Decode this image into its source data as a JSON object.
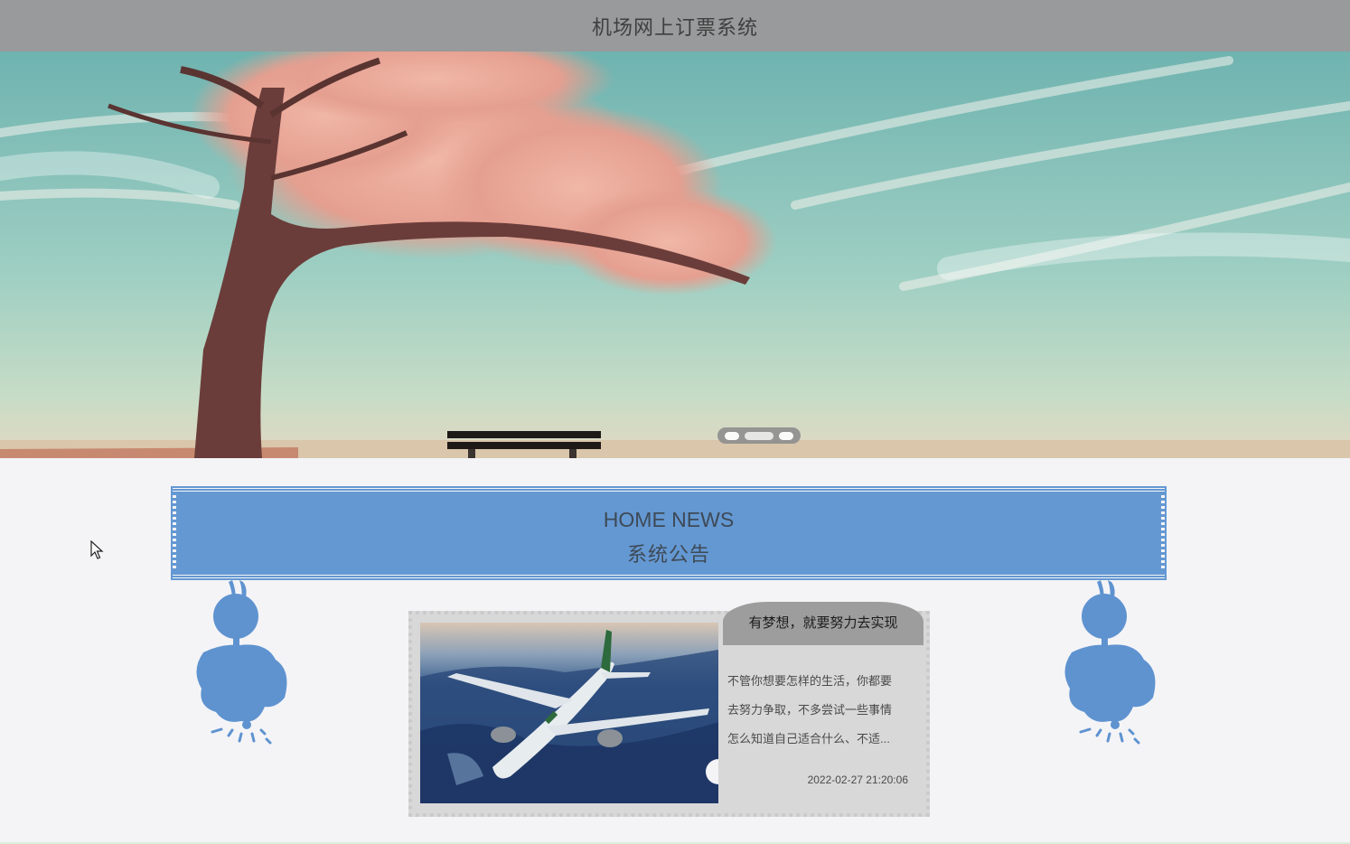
{
  "header": {
    "title": "机场网上订票系统"
  },
  "carousel": {
    "slide_count": 3,
    "active_index": 1
  },
  "news": {
    "title_en": "HOME NEWS",
    "title_zh": "系统公告",
    "items": [
      {
        "title": "有梦想，就要努力去实现",
        "lines": [
          "不管你想要怎样的生活，你都要",
          "去努力争取，不多尝试一些事情",
          "怎么知道自己适合什么、不适..."
        ],
        "date": "2022-02-27 21:20:06",
        "image": "airplane-photo"
      }
    ]
  },
  "colors": {
    "header_bg": "#989a9b",
    "accent": "#6498d2",
    "card_bg": "#d8d8d8"
  }
}
